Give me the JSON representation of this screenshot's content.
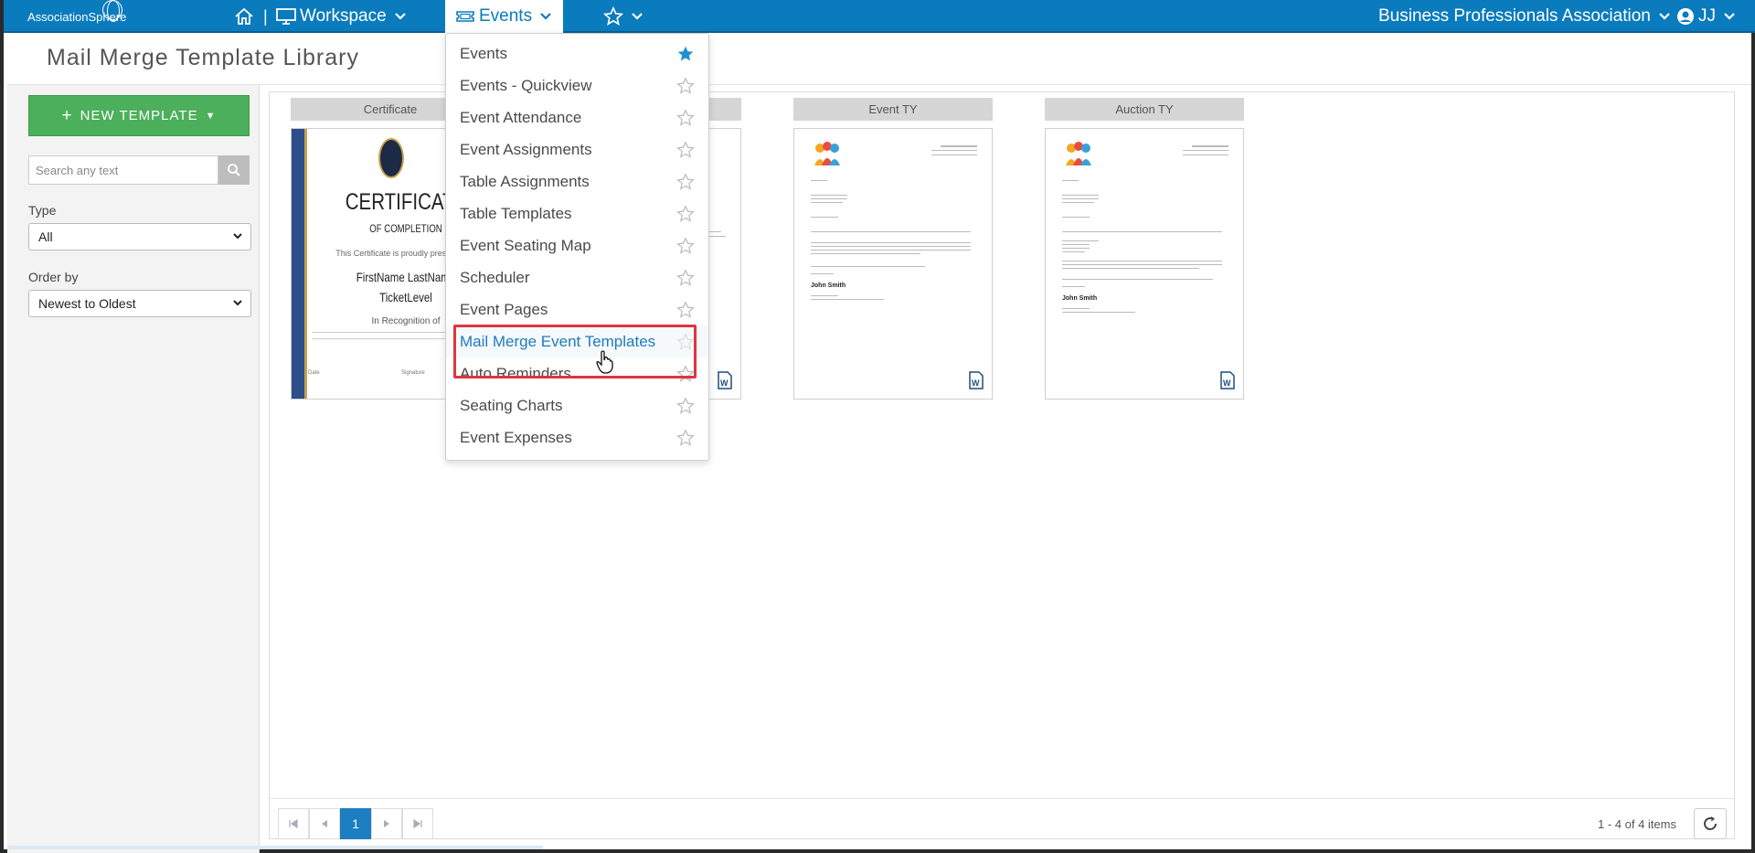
{
  "brand": {
    "logo_text": "AssociationSphere"
  },
  "topnav": {
    "separator": "|",
    "workspace_label": "Workspace",
    "events_label": "Events",
    "org_name": "Business Professionals Association",
    "user_initials": "JJ"
  },
  "page": {
    "title": "Mail Merge Template Library"
  },
  "sidebar": {
    "new_template_label": "NEW TEMPLATE",
    "search_placeholder": "Search any text",
    "type_label": "Type",
    "type_value": "All",
    "order_label": "Order by",
    "order_value": "Newest to Oldest"
  },
  "templates": [
    {
      "title": "Certificate"
    },
    {
      "title": ""
    },
    {
      "title": "Event TY"
    },
    {
      "title": "Auction TY"
    }
  ],
  "certificate_preview": {
    "heading": "CERTIFICATE",
    "sub": "OF COMPLETION",
    "proudly": "This Certificate is proudly presented to",
    "name": "FirstName LastName",
    "level": "TicketLevel",
    "recognition": "In Recognition of",
    "date_label": "Date",
    "signature_label": "Signature"
  },
  "letter_preview": {
    "signer": "John Smith"
  },
  "events_menu": {
    "items": [
      {
        "label": "Events",
        "favorite": true
      },
      {
        "label": "Events - Quickview",
        "favorite": false
      },
      {
        "label": "Event Attendance",
        "favorite": false
      },
      {
        "label": "Event Assignments",
        "favorite": false
      },
      {
        "label": "Table Assignments",
        "favorite": false
      },
      {
        "label": "Table Templates",
        "favorite": false
      },
      {
        "label": "Event Seating Map",
        "favorite": false
      },
      {
        "label": "Scheduler",
        "favorite": false
      },
      {
        "label": "Event Pages",
        "favorite": false
      },
      {
        "label": "Mail Merge Event Templates",
        "favorite": false,
        "active": true
      },
      {
        "label": "Auto Reminders",
        "favorite": false
      },
      {
        "label": "Seating Charts",
        "favorite": false
      },
      {
        "label": "Event Expenses",
        "favorite": false
      }
    ]
  },
  "pager": {
    "current_page": "1",
    "summary": "1 - 4 of 4 items"
  },
  "colors": {
    "nav_bg": "#0a7bbd",
    "primary_button": "#4caf5c",
    "favorite_star": "#1f8fd6",
    "highlight": "#e0353f"
  }
}
